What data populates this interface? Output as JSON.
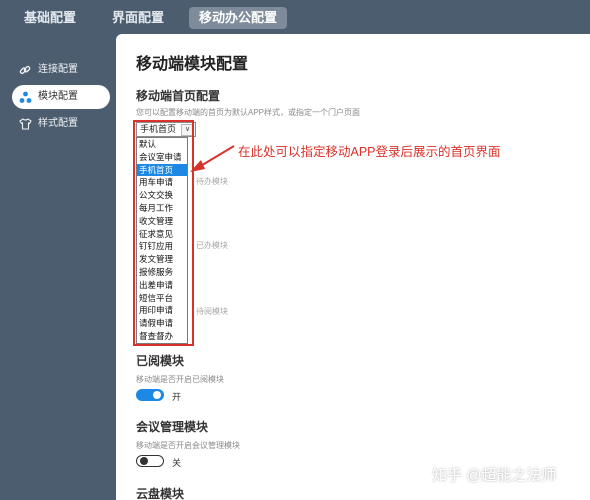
{
  "tabs": [
    {
      "label": "基础配置"
    },
    {
      "label": "界面配置"
    },
    {
      "label": "移动办公配置"
    }
  ],
  "sidebar": {
    "items": [
      {
        "label": "连接配置",
        "icon": "link-icon"
      },
      {
        "label": "模块配置",
        "icon": "modules-icon"
      },
      {
        "label": "样式配置",
        "icon": "shirt-icon"
      }
    ]
  },
  "main": {
    "title": "移动端模块配置",
    "homepage": {
      "title": "移动端首页配置",
      "desc": "您可以配置移动端的首页为默认APP样式，或指定一个门户页面",
      "selected": "手机首页",
      "options": [
        "默认",
        "会议室申请",
        "手机首页",
        "用车申请",
        "公文交换",
        "每月工作",
        "收文管理",
        "征求意见",
        "钉钉应用",
        "发文管理",
        "报修服务",
        "出差申请",
        "短信平台",
        "用印申请",
        "请假申请",
        "督查督办"
      ]
    },
    "hidden_fragments": [
      "待办模块",
      "已办模块",
      "待阅模块"
    ],
    "read_module": {
      "title": "已阅模块",
      "desc": "移动端是否开启已阅模块",
      "state_label": "开"
    },
    "meeting_module": {
      "title": "会议管理模块",
      "desc": "移动端是否开启会议管理模块",
      "state_label": "关"
    },
    "cloud_module": {
      "title": "云盘模块"
    }
  },
  "annotation": {
    "text": "在此处可以指定移动APP登录后展示的首页界面",
    "color": "#d9322a"
  },
  "watermark": "知乎 @超能之法师",
  "colors": {
    "accent": "#1e88e5",
    "sidebar_bg": "#4d5d70",
    "annotation": "#d9322a"
  }
}
